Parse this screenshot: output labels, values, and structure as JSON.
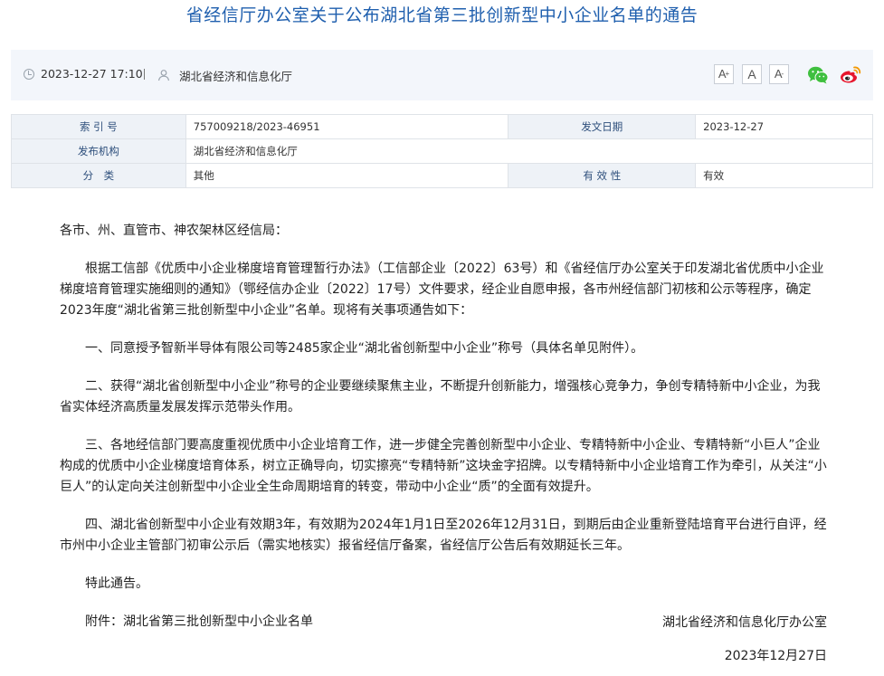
{
  "header": {
    "title": "省经信厅办公室关于公布湖北省第三批创新型中小企业名单的通告"
  },
  "meta": {
    "datetime": "2023-12-27 17:10",
    "separator": "|",
    "source": "湖北省经济和信息化厅",
    "font_buttons": [
      "A",
      "A",
      "A"
    ],
    "share_icons": [
      "wechat-icon",
      "weibo-icon"
    ]
  },
  "info_table": {
    "rows": [
      {
        "k1": "索 引 号",
        "v1": "757009218/2023-46951",
        "k2": "发文日期",
        "v2": "2023-12-27"
      },
      {
        "k1": "发布机构",
        "v1": "湖北省经济和信息化厅"
      },
      {
        "k1": "分　类",
        "v1": "其他",
        "k2": "有 效 性",
        "v2": "有效"
      }
    ]
  },
  "article": {
    "greeting": "各市、州、直管市、神农架林区经信局：",
    "paragraphs": [
      "根据工信部《优质中小企业梯度培育管理暂行办法》（工信部企业〔2022〕63号）和《省经信厅办公室关于印发湖北省优质中小企业梯度培育管理实施细则的通知》（鄂经信办企业〔2022〕17号）文件要求，经企业自愿申报，各市州经信部门初核和公示等程序，确定2023年度“湖北省第三批创新型中小企业”名单。现将有关事项通告如下：",
      "一、同意授予智新半导体有限公司等2485家企业“湖北省创新型中小企业”称号（具体名单见附件）。",
      "二、获得“湖北省创新型中小企业”称号的企业要继续聚焦主业，不断提升创新能力，增强核心竞争力，争创专精特新中小企业，为我省实体经济高质量发展发挥示范带头作用。",
      "三、各地经信部门要高度重视优质中小企业培育工作，进一步健全完善创新型中小企业、专精特新中小企业、专精特新“小巨人”企业构成的优质中小企业梯度培育体系，树立正确导向，切实擦亮“专精特新”这块金字招牌。以专精特新中小企业培育工作为牵引，从关注“小巨人”的认定向关注创新型中小企业全生命周期培育的转变，带动中小企业“质”的全面有效提升。",
      "四、湖北省创新型中小企业有效期3年，有效期为2024年1月1日至2026年12月31日，到期后由企业重新登陆培育平台进行自评，经市州中小企业主管部门初审公示后（需实地核实）报省经信厅备案，省经信厅公告后有效期延长三年。",
      "特此通告。",
      "附件：湖北省第三批创新型中小企业名单"
    ],
    "signature_org": "湖北省经济和信息化厅办公室",
    "signature_date": "2023年12月27日"
  }
}
